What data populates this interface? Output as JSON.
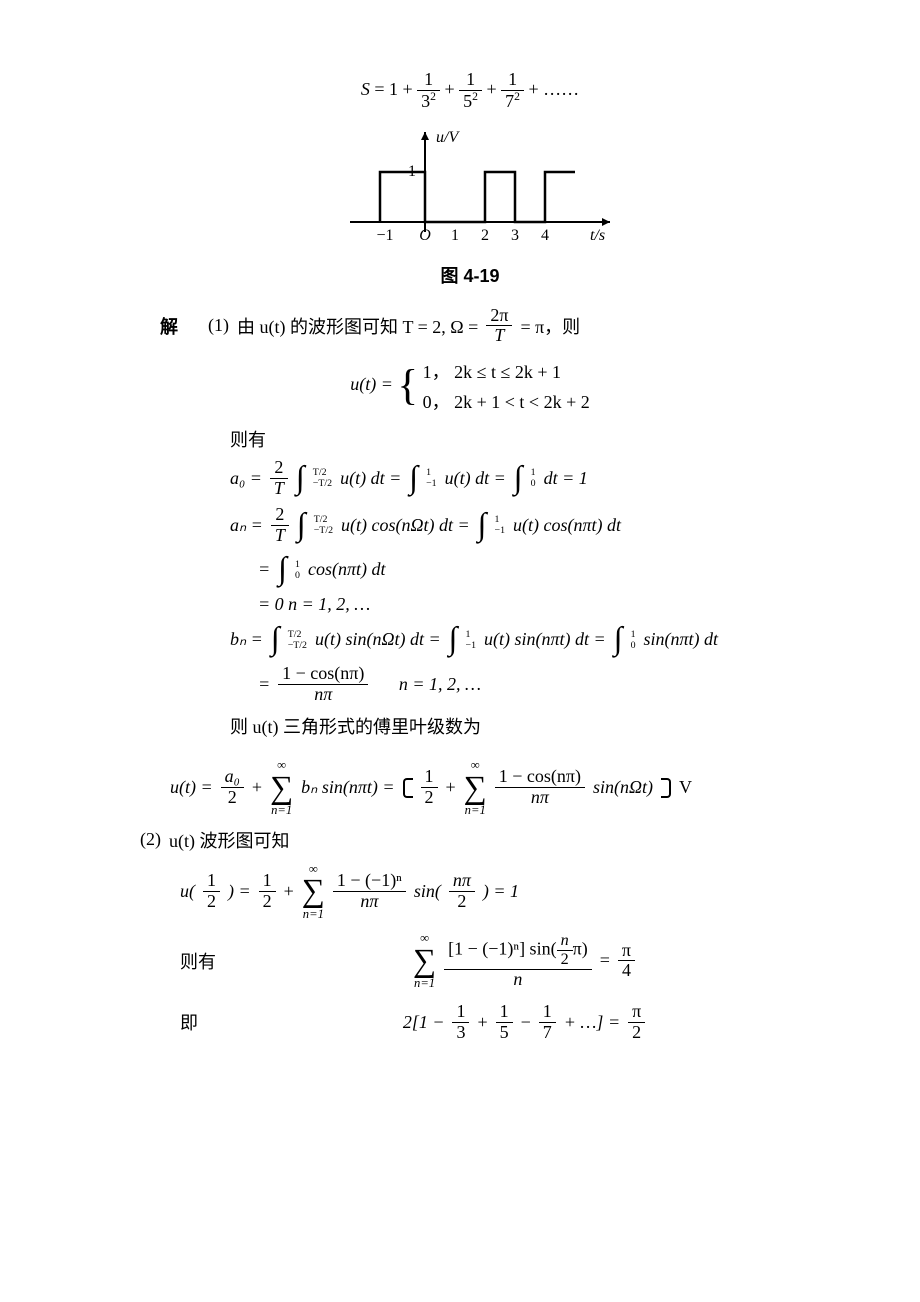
{
  "series_equation": "S = 1 + 1/3² + 1/5² + 1/7² + ……",
  "figure": {
    "ylabel": "u/V",
    "xlabel": "t/s",
    "ymark": "1",
    "xticks": [
      "−1",
      "O",
      "1",
      "2",
      "3",
      "4"
    ],
    "caption": "图 4-19"
  },
  "solution": {
    "heading": "解",
    "part1_label": "(1)",
    "part1_text_a": "由 u(t) 的波形图可知 T = 2, Ω = ",
    "frac_2pi_T_num": "2π",
    "frac_2pi_T_den": "T",
    "part1_text_b": " = π，则",
    "ut_eq": "u(t) = ",
    "case1": "1，    2k ≤ t ≤ 2k + 1",
    "case2": "0，  2k + 1 < t < 2k + 2",
    "then_have": "则有",
    "a0_line": {
      "lhs": "a₀ = ",
      "coef_num": "2",
      "coef_den": "T",
      "int1_lo": "−T/2",
      "int1_hi": "T/2",
      "int1_body": "u(t) dt = ",
      "int2_lo": "−1",
      "int2_hi": "1",
      "int2_body": "u(t) dt = ",
      "int3_lo": "0",
      "int3_hi": "1",
      "int3_body": "dt = 1"
    },
    "an_line1": {
      "lhs": "aₙ = ",
      "coef_num": "2",
      "coef_den": "T",
      "int1_lo": "−T/2",
      "int1_hi": "T/2",
      "int1_body": "u(t) cos(nΩt) dt = ",
      "int2_lo": "−1",
      "int2_hi": "1",
      "int2_body": "u(t) cos(nπt) dt"
    },
    "an_line2": {
      "eq": "= ",
      "int_lo": "0",
      "int_hi": "1",
      "int_body": "cos(nπt) dt"
    },
    "an_line3": "= 0     n = 1, 2, …",
    "bn_line1": {
      "lhs": "bₙ = ",
      "int1_lo": "−T/2",
      "int1_hi": "T/2",
      "int1_body": "u(t) sin(nΩt) dt = ",
      "int2_lo": "−1",
      "int2_hi": "1",
      "int2_body": "u(t) sin(nπt) dt = ",
      "int3_lo": "0",
      "int3_hi": "1",
      "int3_body": "sin(nπt) dt"
    },
    "bn_line2": {
      "eq": "= ",
      "num": "1 − cos(nπ)",
      "den": "nπ",
      "tail": "     n = 1, 2, …"
    },
    "trig_text": "则 u(t) 三角形式的傅里叶级数为",
    "ut_series": {
      "lhs": "u(t) = ",
      "a0_num": "a₀",
      "a0_den": "2",
      "plus": " + ",
      "sum_top": "∞",
      "sum_bot": "n=1",
      "term1": "bₙ sin(nπt) = ",
      "half_num": "1",
      "half_den": "2",
      "frac2_num": "1 − cos(nπ)",
      "frac2_den": "nπ",
      "term2_tail": " sin(nΩt)",
      "unit": " V"
    },
    "part2_label": "(2)",
    "part2_text": "u(t) 波形图可知",
    "u_half": {
      "lhs_l": "u(",
      "lhs_num": "1",
      "lhs_den": "2",
      "lhs_r": ") = ",
      "half_num": "1",
      "half_den": "2",
      "plus": " + ",
      "sum_top": "∞",
      "sum_bot": "n=1",
      "frac_num": "1 − (−1)ⁿ",
      "frac_den": "nπ",
      "sin_l": " sin(",
      "sin_num": "nπ",
      "sin_den": "2",
      "sin_r": ") = 1"
    },
    "then_have2": "则有",
    "sum_eq": {
      "sum_top": "∞",
      "sum_bot": "n=1",
      "num_l": "[1 − (−1)ⁿ] sin(",
      "num_frac_num": "n",
      "num_frac_den": "2",
      "num_r": "π)",
      "den": "n",
      "rhs_num": "π",
      "rhs_den": "4"
    },
    "ie": "即",
    "final": {
      "lhs": "2[1 − ",
      "f1n": "1",
      "f1d": "3",
      "mid1": " + ",
      "f2n": "1",
      "f2d": "5",
      "mid2": " − ",
      "f3n": "1",
      "f3d": "7",
      "tail": " + …] = ",
      "rhs_num": "π",
      "rhs_den": "2"
    }
  },
  "chart_data": {
    "type": "line",
    "title": "",
    "xlabel": "t/s",
    "ylabel": "u/V",
    "x": [
      -1,
      0,
      0,
      1,
      1,
      2,
      2,
      3,
      3,
      4,
      4
    ],
    "y": [
      1,
      1,
      0,
      0,
      0,
      0,
      1,
      1,
      0,
      0,
      1
    ],
    "note": "Periodic square wave: u=1 on [2k, 2k+1], u=0 on (2k+1, 2k+2); period T=2; amplitude 1 V.",
    "ylim": [
      0,
      1
    ],
    "xticks": [
      -1,
      0,
      1,
      2,
      3,
      4
    ]
  }
}
